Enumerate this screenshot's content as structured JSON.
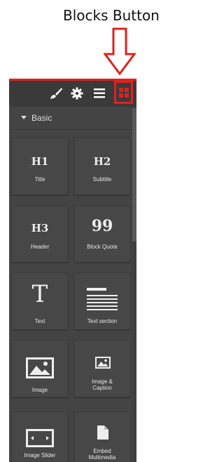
{
  "annotation": {
    "label": "Blocks Button"
  },
  "toolbar": {
    "icons": [
      "brush-icon",
      "gear-icon",
      "hamburger-icon",
      "blocks-grid-icon"
    ],
    "accent": "#e0211e"
  },
  "category": {
    "label": "Basic"
  },
  "blocks": {
    "h1": {
      "icon_text": "H1",
      "label": "Title"
    },
    "h2": {
      "icon_text": "H2",
      "label": "Subtitle"
    },
    "h3": {
      "icon_text": "H3",
      "label": "Header"
    },
    "quote": {
      "icon_text": "99",
      "label": "Block Quote"
    },
    "text": {
      "icon_text": "T",
      "label": "Text"
    },
    "text_section": {
      "label": "Text section"
    },
    "image": {
      "label": "Image"
    },
    "image_caption": {
      "label_line1": "Image &",
      "label_line2": "Caption"
    },
    "image_slider": {
      "label": "Image Slider"
    },
    "embed": {
      "label_line1": "Embed",
      "label_line2": "Multimedia"
    }
  }
}
